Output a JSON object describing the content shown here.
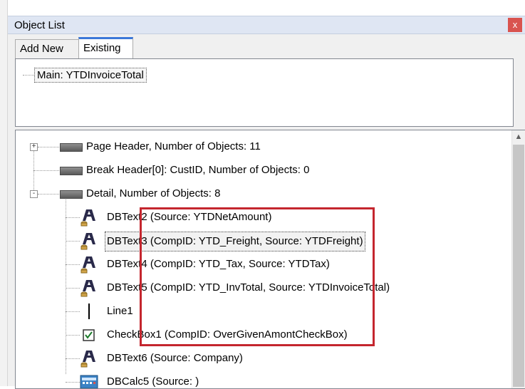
{
  "panel": {
    "title": "Object List",
    "close_label": "x",
    "tabs": [
      {
        "label": "Add New",
        "active": false
      },
      {
        "label": "Existing",
        "active": true
      }
    ]
  },
  "top_tree": {
    "main_label": "Main: YTDInvoiceTotal"
  },
  "tree": {
    "items": [
      {
        "label": "Page Header, Number of Objects: 11",
        "icon": "band-icon",
        "expander": "+"
      },
      {
        "label": "Break Header[0]: CustID, Number of Objects: 0",
        "icon": "band-icon"
      },
      {
        "label": "Detail, Number of Objects: 8",
        "icon": "band-icon",
        "expander": "-"
      },
      {
        "label": "DBText2 (Source: YTDNetAmount)",
        "icon": "dbtext-icon"
      },
      {
        "label": "DBText3 (CompID: YTD_Freight, Source: YTDFreight)",
        "icon": "dbtext-icon",
        "selected": true
      },
      {
        "label": "DBText4 (CompID: YTD_Tax, Source: YTDTax)",
        "icon": "dbtext-icon"
      },
      {
        "label": "DBText5 (CompID: YTD_InvTotal, Source: YTDInvoiceTotal)",
        "icon": "dbtext-icon"
      },
      {
        "label": "Line1",
        "icon": "line-icon"
      },
      {
        "label": "CheckBox1 (CompID: OverGivenAmontCheckBox)",
        "icon": "checkbox-icon"
      },
      {
        "label": "DBText6 (Source: Company)",
        "icon": "dbtext-icon"
      },
      {
        "label": "DBCalc5 (Source: )",
        "icon": "dbcalc-icon"
      }
    ]
  },
  "colors": {
    "highlight_box": "#c4262e",
    "tab_accent": "#3c78d8",
    "title_bar": "#dfe6f3"
  }
}
